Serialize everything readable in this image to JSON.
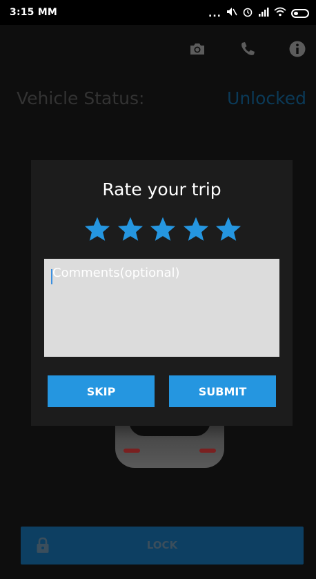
{
  "status_bar": {
    "time": "3:15 MM",
    "dots": "...",
    "icons": [
      "mute-icon",
      "alarm-icon",
      "signal-icon",
      "wifi-icon",
      "battery-icon"
    ]
  },
  "toolbar": {
    "icons": [
      "camera-icon",
      "phone-icon",
      "info-icon"
    ]
  },
  "vehicle": {
    "label": "Vehicle Status:",
    "status": "Unlocked"
  },
  "rating_dialog": {
    "title": "Rate your trip",
    "rating": 5,
    "max_rating": 5,
    "comment_placeholder": "Comments(optional)",
    "comment_value": "",
    "skip_label": "SKIP",
    "submit_label": "SUBMIT"
  },
  "lock_bar": {
    "label": "LOCK"
  },
  "colors": {
    "accent": "#2596e0",
    "star": "#2596e0",
    "status_value": "#0b3a58",
    "lock_bar": "#0d3f62"
  }
}
